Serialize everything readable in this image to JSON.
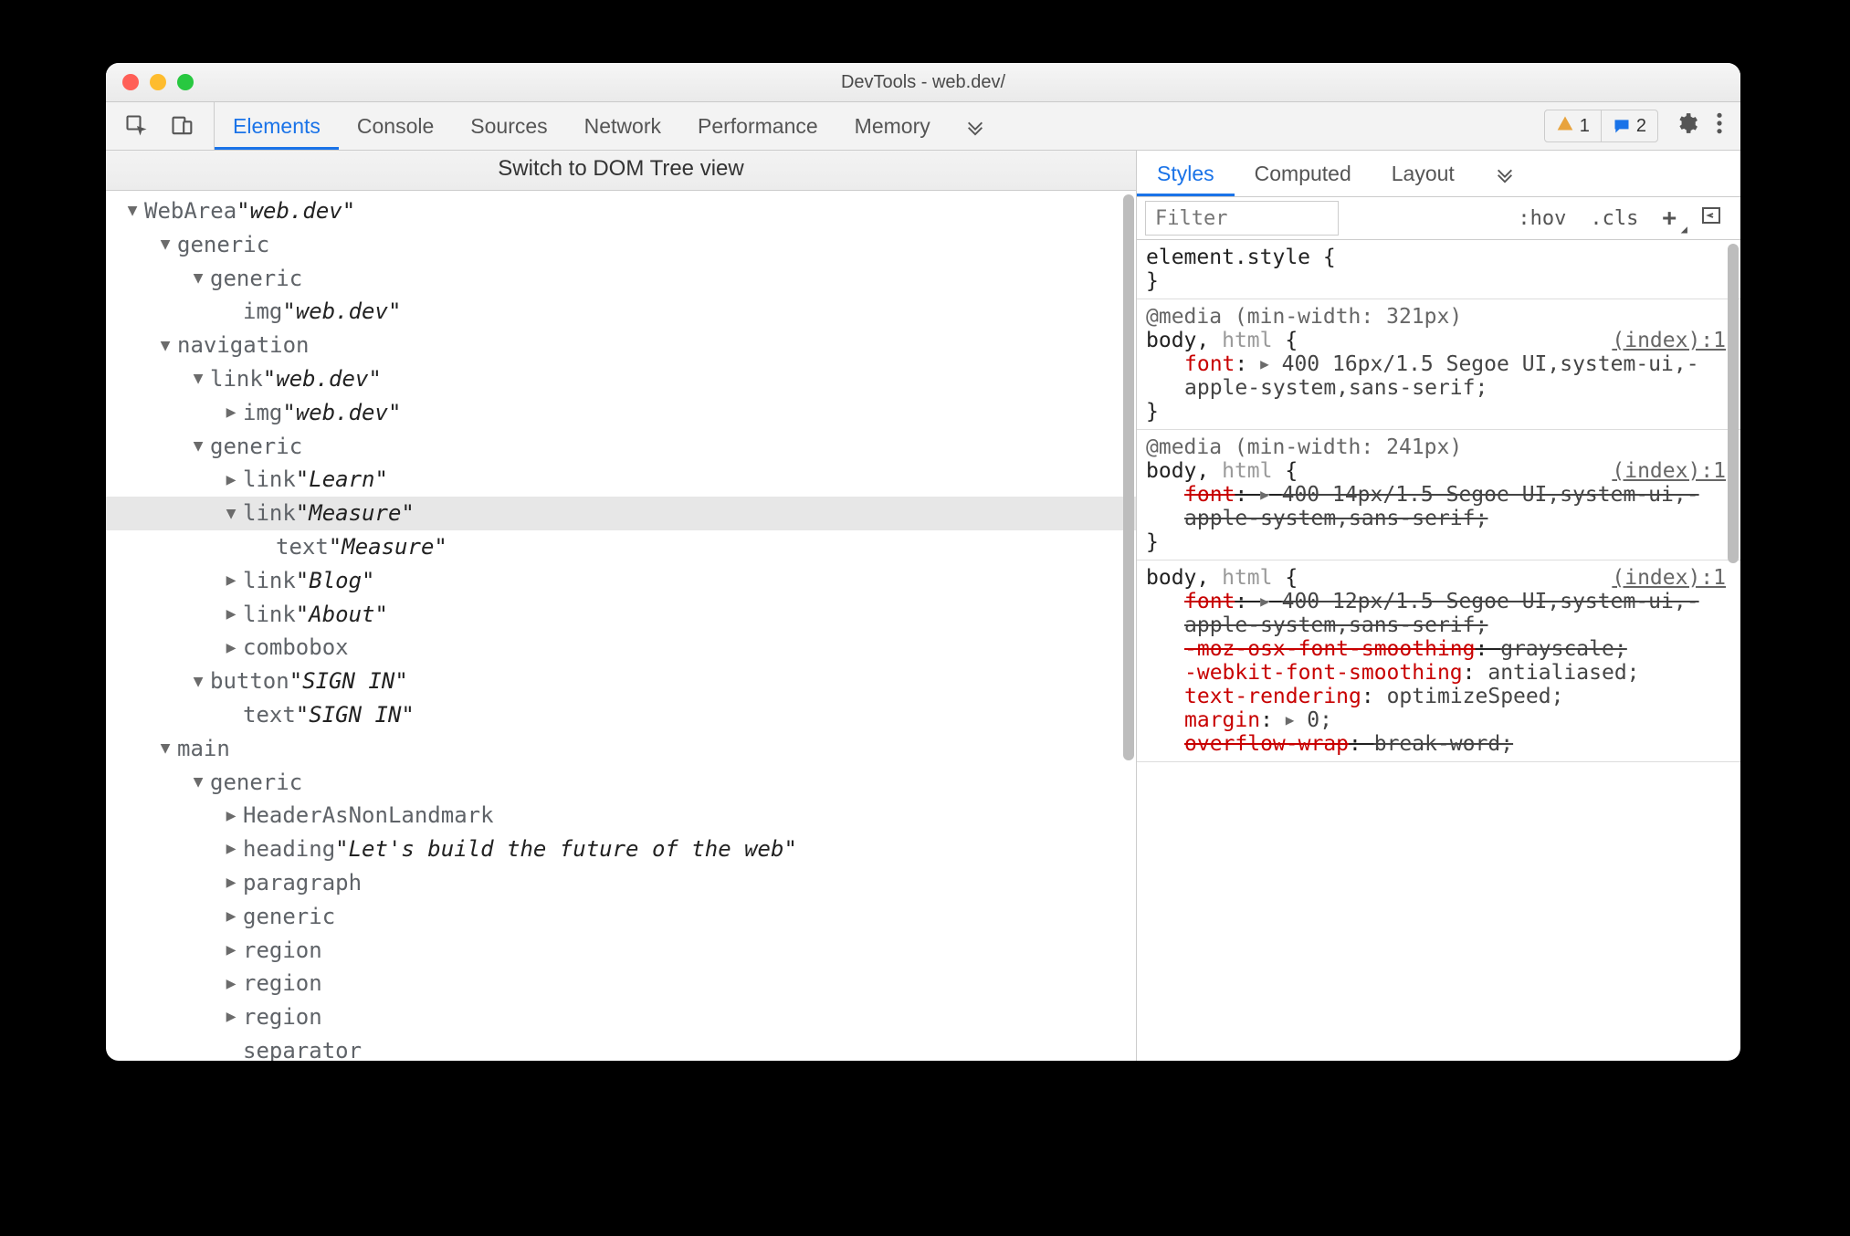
{
  "window": {
    "title": "DevTools - web.dev/"
  },
  "toolbar": {
    "tabs": [
      "Elements",
      "Console",
      "Sources",
      "Network",
      "Performance",
      "Memory"
    ],
    "active_tab_index": 0,
    "warning_count": "1",
    "message_count": "2"
  },
  "tree": {
    "switch_label": "Switch to DOM Tree view",
    "rows": [
      {
        "d": 0,
        "a": "down",
        "role": "WebArea",
        "name": "web.dev",
        "sel": false
      },
      {
        "d": 1,
        "a": "down",
        "role": "generic",
        "sel": false
      },
      {
        "d": 2,
        "a": "down",
        "role": "generic",
        "sel": false
      },
      {
        "d": 3,
        "a": "none",
        "role": "img",
        "name": "web.dev",
        "sel": false
      },
      {
        "d": 1,
        "a": "down",
        "role": "navigation",
        "sel": false
      },
      {
        "d": 2,
        "a": "down",
        "role": "link",
        "name": "web.dev",
        "sel": false
      },
      {
        "d": 3,
        "a": "right",
        "role": "img",
        "name": "web.dev",
        "sel": false
      },
      {
        "d": 2,
        "a": "down",
        "role": "generic",
        "sel": false
      },
      {
        "d": 3,
        "a": "right",
        "role": "link",
        "name": "Learn",
        "sel": false
      },
      {
        "d": 3,
        "a": "down",
        "role": "link",
        "name": "Measure",
        "sel": true
      },
      {
        "d": 4,
        "a": "none",
        "role": "text",
        "name": "Measure",
        "sel": false
      },
      {
        "d": 3,
        "a": "right",
        "role": "link",
        "name": "Blog",
        "sel": false
      },
      {
        "d": 3,
        "a": "right",
        "role": "link",
        "name": "About",
        "sel": false
      },
      {
        "d": 3,
        "a": "right",
        "role": "combobox",
        "sel": false
      },
      {
        "d": 2,
        "a": "down",
        "role": "button",
        "name": "SIGN IN",
        "sel": false
      },
      {
        "d": 3,
        "a": "none",
        "role": "text",
        "name": "SIGN IN",
        "sel": false
      },
      {
        "d": 1,
        "a": "down",
        "role": "main",
        "sel": false
      },
      {
        "d": 2,
        "a": "down",
        "role": "generic",
        "sel": false
      },
      {
        "d": 3,
        "a": "right",
        "role": "HeaderAsNonLandmark",
        "sel": false
      },
      {
        "d": 3,
        "a": "right",
        "role": "heading",
        "name": "Let's build the future of the web",
        "sel": false
      },
      {
        "d": 3,
        "a": "right",
        "role": "paragraph",
        "sel": false
      },
      {
        "d": 3,
        "a": "right",
        "role": "generic",
        "sel": false
      },
      {
        "d": 3,
        "a": "right",
        "role": "region",
        "sel": false
      },
      {
        "d": 3,
        "a": "right",
        "role": "region",
        "sel": false
      },
      {
        "d": 3,
        "a": "right",
        "role": "region",
        "sel": false
      },
      {
        "d": 3,
        "a": "none",
        "role": "separator",
        "sel": false
      }
    ]
  },
  "styles": {
    "tabs": [
      "Styles",
      "Computed",
      "Layout"
    ],
    "active_tab_index": 0,
    "filter_placeholder": "Filter",
    "hov": ":hov",
    "cls": ".cls",
    "element_style_header": "element.style {",
    "brace_close": "}",
    "rules": [
      {
        "media": "@media (min-width: 321px)",
        "selector_main": "body,",
        "selector_dim": " html",
        "src": "(index):1",
        "decls": [
          {
            "expand": true,
            "struck": false,
            "prop": "font",
            "val": "400 16px/1.5 Segoe UI,system-ui,-apple-system,sans-serif;"
          }
        ]
      },
      {
        "media": "@media (min-width: 241px)",
        "selector_main": "body,",
        "selector_dim": " html",
        "src": "(index):1",
        "decls": [
          {
            "expand": true,
            "struck": true,
            "prop": "font",
            "val": "400 14px/1.5 Segoe UI,system-ui,-apple-system,sans-serif;"
          }
        ]
      },
      {
        "media": null,
        "selector_main": "body,",
        "selector_dim": " html",
        "src": "(index):1",
        "decls": [
          {
            "expand": true,
            "struck": true,
            "prop": "font",
            "val": "400 12px/1.5 Segoe UI,system-ui,-apple-system,sans-serif;"
          },
          {
            "expand": false,
            "struck": true,
            "prop": "-moz-osx-font-smoothing",
            "val": "grayscale;"
          },
          {
            "expand": false,
            "struck": false,
            "prop": "-webkit-font-smoothing",
            "val": "antialiased;"
          },
          {
            "expand": false,
            "struck": false,
            "prop": "text-rendering",
            "val": "optimizeSpeed;"
          },
          {
            "expand": true,
            "struck": false,
            "prop": "margin",
            "val": "0;"
          },
          {
            "expand": false,
            "struck": true,
            "prop": "overflow-wrap",
            "val": "break-word;"
          }
        ],
        "open": true
      }
    ]
  }
}
